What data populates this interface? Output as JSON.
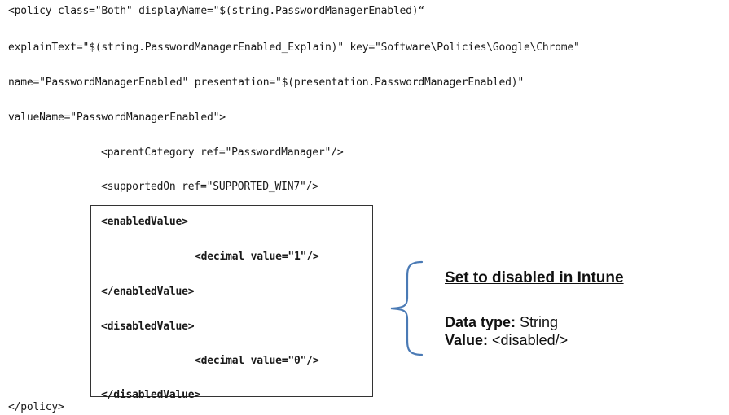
{
  "code": {
    "policy_open_1": "<policy class=\"Both\" displayName=\"$(string.PasswordManagerEnabled)“",
    "policy_open_2": "explainText=\"$(string.PasswordManagerEnabled_Explain)\" key=\"Software\\Policies\\Google\\Chrome\"",
    "policy_open_3": "name=\"PasswordManagerEnabled\" presentation=\"$(presentation.PasswordManagerEnabled)\"",
    "policy_open_4": "valueName=\"PasswordManagerEnabled\">",
    "parent_category": "<parentCategory ref=\"PasswordManager\"/>",
    "supported_on": "<supportedOn ref=\"SUPPORTED_WIN7\"/>",
    "enabled_open": "<enabledValue>",
    "enabled_decimal": "<decimal value=\"1\"/>",
    "enabled_close": "</enabledValue>",
    "disabled_open": "<disabledValue>",
    "disabled_decimal": "<decimal value=\"0\"/>",
    "disabled_close": "</disabledValue>",
    "policy_close": "</policy>"
  },
  "annotation": {
    "title": "Set to disabled in Intune",
    "data_type_label": "Data type:",
    "data_type_value": " String",
    "value_label": "Value:",
    "value_value": " <disabled/>"
  },
  "colors": {
    "brace": "#4a7ab5",
    "box_border": "#333333",
    "text": "#1a1a1a"
  }
}
